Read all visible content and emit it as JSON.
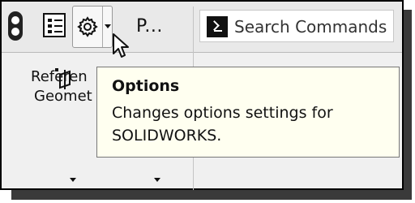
{
  "toolbar": {
    "truncated_label": "P...",
    "search_placeholder": "Search Commands"
  },
  "ribbon": {
    "reference_geometry_line1": "Referen",
    "reference_geometry_line2": "Geomet"
  },
  "tooltip": {
    "title": "Options",
    "description": "Changes options settings for SOLIDWORKS."
  },
  "icons": [
    "traffic-light-icon",
    "property-manager-icon",
    "gear-icon",
    "terminal-icon",
    "reference-geometry-icon",
    "mouse-cursor-icon"
  ]
}
